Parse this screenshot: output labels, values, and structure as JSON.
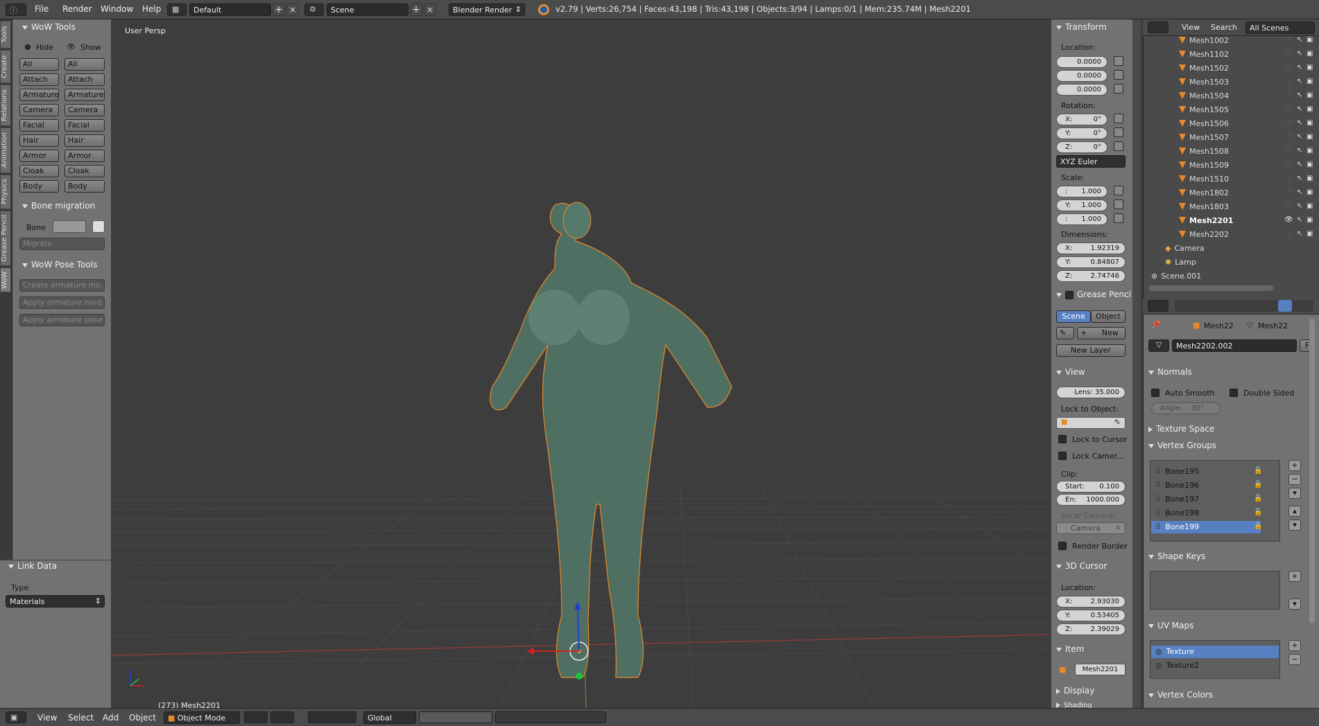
{
  "topbar": {
    "menus": [
      "File",
      "Render",
      "Window",
      "Help"
    ],
    "layout": "Default",
    "scene": "Scene",
    "engine": "Blender Render",
    "stats": "v2.79 | Verts:26,754 | Faces:43,198 | Tris:43,198 | Objects:3/94 | Lamps:0/1 | Mem:235.74M | Mesh2201"
  },
  "lefttabs": [
    "Tools",
    "Create",
    "Relations",
    "Animation",
    "Physics",
    "Grease Pencil",
    "WoW"
  ],
  "wowtools": {
    "title": "WoW Tools",
    "hide": "Hide",
    "show": "Show",
    "buttons": [
      "All",
      "Attach",
      "Armature",
      "Camera",
      "Facial",
      "Hair",
      "Armor",
      "Cloak",
      "Body"
    ]
  },
  "bonemig": {
    "title": "Bone migration",
    "bone_label": "Bone",
    "migrate": "Migrate"
  },
  "posetools": {
    "title": "WoW Pose Tools",
    "buttons": [
      "Create armature mo...",
      "Apply armature mod...",
      "Apply armature pose"
    ]
  },
  "linkdata": {
    "title": "Link Data",
    "type_label": "Type",
    "type_value": "Materials"
  },
  "viewport": {
    "persp": "User Persp",
    "object_label": "(273) Mesh2201"
  },
  "bottombar": {
    "menus": [
      "View",
      "Select",
      "Add",
      "Object"
    ],
    "mode": "Object Mode",
    "orientation": "Global"
  },
  "transform": {
    "title": "Transform",
    "location_label": "Location:",
    "location": [
      "0.0000",
      "0.0000",
      "0.0000"
    ],
    "rotation_label": "Rotation:",
    "rotation": [
      {
        "l": "X:",
        "v": "0°"
      },
      {
        "l": "Y:",
        "v": "0°"
      },
      {
        "l": "Z:",
        "v": "0°"
      }
    ],
    "rotation_mode": "XYZ Euler",
    "scale_label": "Scale:",
    "scale": [
      {
        "l": ":",
        "v": "1.000"
      },
      {
        "l": "Y:",
        "v": "1.000"
      },
      {
        "l": ":",
        "v": "1.000"
      }
    ],
    "dims_label": "Dimensions:",
    "dims": [
      {
        "l": "X:",
        "v": "1.92319"
      },
      {
        "l": "Y:",
        "v": "0.84807"
      },
      {
        "l": "Z:",
        "v": "2.74746"
      }
    ]
  },
  "grease": {
    "title": "Grease Penci",
    "scene": "Scene",
    "object": "Object",
    "new": "New",
    "new_layer": "New Layer"
  },
  "view": {
    "title": "View",
    "lens": "Lens: 35.000",
    "lock_obj": "Lock to Object:",
    "lock_cursor": "Lock to Cursor",
    "lock_camera": "Lock Camer...",
    "clip": "Clip:",
    "start": "Start:",
    "start_v": "0.100",
    "end": "En:",
    "end_v": "1000.000",
    "local_camera": "Local Camera:",
    "camera": "Camera",
    "render_border": "Render Border"
  },
  "cursor3d": {
    "title": "3D Cursor",
    "location_label": "Location:",
    "loc": [
      {
        "l": "X:",
        "v": "2.93030"
      },
      {
        "l": "Y:",
        "v": "0.53405"
      },
      {
        "l": "Z:",
        "v": "2.39029"
      }
    ]
  },
  "item": {
    "title": "Item",
    "name": "Mesh2201"
  },
  "display": {
    "title": "Display"
  },
  "shading": {
    "title": "Shading"
  },
  "outliner": {
    "view": "View",
    "search": "Search",
    "scenes": "All Scenes",
    "meshes": [
      "Mesh1002",
      "Mesh1102",
      "Mesh1502",
      "Mesh1503",
      "Mesh1504",
      "Mesh1505",
      "Mesh1506",
      "Mesh1507",
      "Mesh1508",
      "Mesh1509",
      "Mesh1510",
      "Mesh1802",
      "Mesh1803",
      "Mesh2201",
      "Mesh2202"
    ],
    "camera": "Camera",
    "lamp": "Lamp",
    "scene001": "Scene.001"
  },
  "props": {
    "bc_obj": "Mesh22",
    "bc_mesh": "Mesh22",
    "mesh_name": "Mesh2202.002",
    "f": "F",
    "normals": "Normals",
    "auto_smooth": "Auto Smooth",
    "double_sided": "Double Sided",
    "angle_label": "Angle:",
    "angle": "30°",
    "texture_space": "Texture Space",
    "vertex_groups": "Vertex Groups",
    "groups": [
      "Bone195",
      "Bone196",
      "Bone197",
      "Bone198",
      "Bone199"
    ],
    "shape_keys": "Shape Keys",
    "uv_maps": "UV Maps",
    "uvs": [
      "Texture",
      "Texture2"
    ],
    "vertex_colors": "Vertex Colors"
  },
  "colors": {
    "accent": "#5680c2",
    "selection": "#e88a2a"
  }
}
